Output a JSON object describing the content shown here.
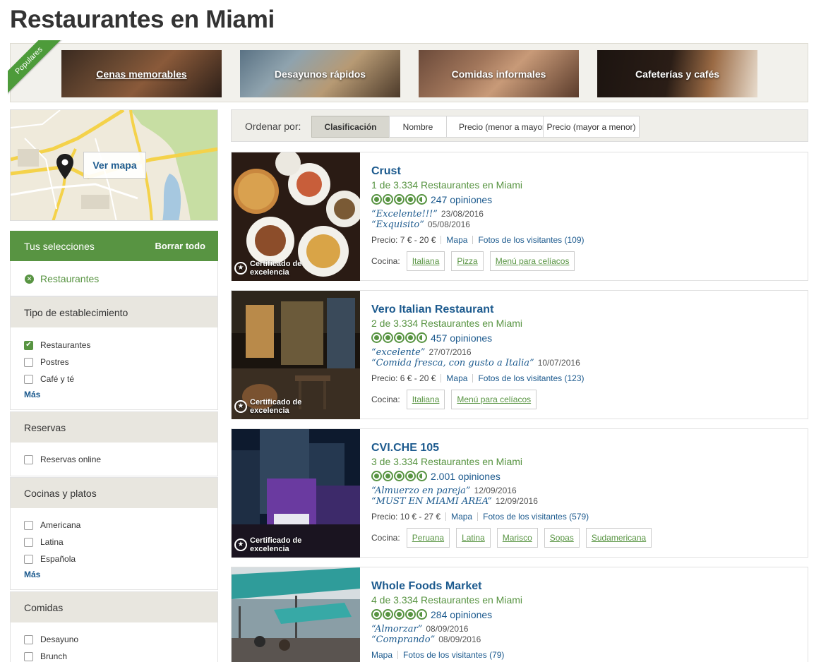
{
  "page_title": "Restaurantes en Miami",
  "popular": {
    "ribbon": "Populares",
    "categories": [
      {
        "label": "Cenas memorables"
      },
      {
        "label": "Desayunos rápidos"
      },
      {
        "label": "Comidas informales"
      },
      {
        "label": "Cafeterías y cafés"
      }
    ]
  },
  "map": {
    "button": "Ver mapa"
  },
  "selections": {
    "title": "Tus selecciones",
    "clear": "Borrar todo",
    "chip": "Restaurantes"
  },
  "filters": [
    {
      "title": "Tipo de establecimiento",
      "options": [
        {
          "label": "Restaurantes",
          "checked": true
        },
        {
          "label": "Postres",
          "checked": false
        },
        {
          "label": "Café y té",
          "checked": false
        }
      ],
      "more": "Más"
    },
    {
      "title": "Reservas",
      "options": [
        {
          "label": "Reservas online",
          "checked": false
        }
      ]
    },
    {
      "title": "Cocinas y platos",
      "options": [
        {
          "label": "Americana",
          "checked": false
        },
        {
          "label": "Latina",
          "checked": false
        },
        {
          "label": "Española",
          "checked": false
        }
      ],
      "more": "Más"
    },
    {
      "title": "Comidas",
      "options": [
        {
          "label": "Desayuno",
          "checked": false
        },
        {
          "label": "Brunch",
          "checked": false
        }
      ]
    }
  ],
  "sort": {
    "label": "Ordenar por:",
    "options": [
      "Clasificación",
      "Nombre",
      "Precio (menor a mayor)",
      "Precio (mayor a menor)"
    ],
    "active": "Clasificación"
  },
  "badge_text": [
    "Certificado de",
    "excelencia"
  ],
  "labels": {
    "price": "Precio:",
    "map": "Mapa",
    "cuisine": "Cocina:"
  },
  "listings": [
    {
      "name": "Crust",
      "rank": "1 de 3.334 Restaurantes en Miami",
      "rating": 4.5,
      "reviews": "247 opiniones",
      "quotes": [
        {
          "text": "Excelente!!!",
          "date": "23/08/2016"
        },
        {
          "text": "Exquisito",
          "date": "05/08/2016"
        }
      ],
      "price": "7 € - 20 €",
      "photos": "Fotos de los visitantes (109)",
      "cuisines": [
        "Italiana",
        "Pizza",
        "Menú para celíacos"
      ]
    },
    {
      "name": "Vero Italian Restaurant",
      "rank": "2 de 3.334 Restaurantes en Miami",
      "rating": 4.5,
      "reviews": "457 opiniones",
      "quotes": [
        {
          "text": "excelente",
          "date": "27/07/2016"
        },
        {
          "text": "Comida fresca, con gusto a Italia",
          "date": "10/07/2016"
        }
      ],
      "price": "6 € - 20 €",
      "photos": "Fotos de los visitantes (123)",
      "cuisines": [
        "Italiana",
        "Menú para celíacos"
      ]
    },
    {
      "name": "CVI.CHE 105",
      "rank": "3 de 3.334 Restaurantes en Miami",
      "rating": 4.5,
      "reviews": "2.001 opiniones",
      "quotes": [
        {
          "text": "Almuerzo en pareja",
          "date": "12/09/2016"
        },
        {
          "text": "MUST EN MIAMI AREA",
          "date": "12/09/2016"
        }
      ],
      "price": "10 € - 27 €",
      "photos": "Fotos de los visitantes (579)",
      "cuisines": [
        "Peruana",
        "Latina",
        "Marisco",
        "Sopas",
        "Sudamericana"
      ]
    },
    {
      "name": "Whole Foods Market",
      "rank": "4 de 3.334 Restaurantes en Miami",
      "rating": 4.5,
      "reviews": "284 opiniones",
      "quotes": [
        {
          "text": "Almorzar",
          "date": "08/09/2016"
        },
        {
          "text": "Comprando",
          "date": "08/09/2016"
        }
      ],
      "photos": "Fotos de los visitantes (79)"
    }
  ],
  "colors": {
    "brand_green": "#589442",
    "link_blue": "#1c5a8e",
    "rank_green": "#589442"
  }
}
